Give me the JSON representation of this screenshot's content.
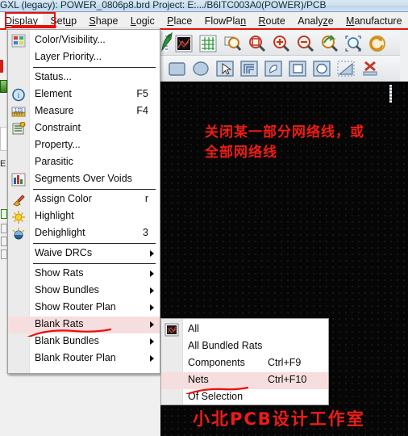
{
  "window": {
    "title": "GXL (legacy): POWER_0806p8.brd  Project: E:.../B6ITC003A0(POWER)/PCB"
  },
  "menubar": {
    "items": [
      {
        "label": "Display",
        "mnemonic": "D",
        "active": true
      },
      {
        "label": "Setup",
        "mnemonic": "u",
        "active": false
      },
      {
        "label": "Shape",
        "mnemonic": "S",
        "active": false
      },
      {
        "label": "Logic",
        "mnemonic": "L",
        "active": false
      },
      {
        "label": "Place",
        "mnemonic": "P",
        "active": false
      },
      {
        "label": "FlowPlan",
        "mnemonic": "n",
        "active": false
      },
      {
        "label": "Route",
        "mnemonic": "R",
        "active": false
      },
      {
        "label": "Analyze",
        "mnemonic": "z",
        "active": false
      },
      {
        "label": "Manufacture",
        "mnemonic": "M",
        "active": false
      }
    ]
  },
  "display_menu": {
    "items": [
      {
        "label": "Color/Visibility...",
        "accel": "",
        "submenu": false,
        "icon": "color-visibility-icon",
        "highlighted": false
      },
      {
        "label": "Layer Priority...",
        "accel": "",
        "submenu": false,
        "icon": "",
        "highlighted": false
      },
      {
        "separator": true
      },
      {
        "label": "Status...",
        "accel": "",
        "submenu": false,
        "icon": "",
        "highlighted": false
      },
      {
        "label": "Element",
        "accel": "F5",
        "submenu": false,
        "icon": "info-icon",
        "highlighted": false
      },
      {
        "label": "Measure",
        "accel": "F4",
        "submenu": false,
        "icon": "ruler-icon",
        "highlighted": false
      },
      {
        "label": "Constraint",
        "accel": "",
        "submenu": false,
        "icon": "constraint-icon",
        "highlighted": false
      },
      {
        "label": "Property...",
        "accel": "",
        "submenu": false,
        "icon": "",
        "highlighted": false
      },
      {
        "label": "Parasitic",
        "accel": "",
        "submenu": false,
        "icon": "",
        "highlighted": false
      },
      {
        "label": "Segments Over Voids",
        "accel": "",
        "submenu": false,
        "icon": "bargraph-icon",
        "highlighted": false
      },
      {
        "separator": true
      },
      {
        "label": "Assign Color",
        "accel": "r",
        "submenu": false,
        "icon": "paint-icon",
        "highlighted": false
      },
      {
        "label": "Highlight",
        "accel": "",
        "submenu": false,
        "icon": "highlight-icon",
        "highlighted": false
      },
      {
        "label": "Dehighlight",
        "accel": "3",
        "submenu": false,
        "icon": "dehighlight-icon",
        "highlighted": false
      },
      {
        "separator": true
      },
      {
        "label": "Waive DRCs",
        "accel": "",
        "submenu": true,
        "icon": "",
        "highlighted": false
      },
      {
        "separator": true
      },
      {
        "label": "Show Rats",
        "accel": "",
        "submenu": true,
        "icon": "",
        "highlighted": false
      },
      {
        "label": "Show Bundles",
        "accel": "",
        "submenu": true,
        "icon": "",
        "highlighted": false
      },
      {
        "label": "Show Router Plan",
        "accel": "",
        "submenu": true,
        "icon": "",
        "highlighted": false
      },
      {
        "label": "Blank Rats",
        "accel": "",
        "submenu": true,
        "icon": "",
        "highlighted": true
      },
      {
        "label": "Blank Bundles",
        "accel": "",
        "submenu": true,
        "icon": "",
        "highlighted": false
      },
      {
        "label": "Blank Router Plan",
        "accel": "",
        "submenu": true,
        "icon": "",
        "highlighted": false
      }
    ]
  },
  "blank_rats_submenu": {
    "items": [
      {
        "label": "All",
        "accel": "",
        "icon": "rats-icon",
        "highlighted": false
      },
      {
        "label": "All Bundled Rats",
        "accel": "",
        "icon": "",
        "highlighted": false
      },
      {
        "label": "Components",
        "accel": "Ctrl+F9",
        "icon": "",
        "highlighted": false
      },
      {
        "label": "Nets",
        "accel": "Ctrl+F10",
        "icon": "",
        "highlighted": true
      },
      {
        "label": "Of Selection",
        "accel": "",
        "icon": "",
        "highlighted": false
      }
    ]
  },
  "toolbar": {
    "row1": [
      {
        "name": "display-color-visibility-button"
      },
      {
        "name": "display-grid-button"
      },
      {
        "name": "zoom-fit-button"
      },
      {
        "name": "zoom-by-points-button"
      },
      {
        "name": "zoom-in-button"
      },
      {
        "name": "zoom-out-button"
      },
      {
        "name": "zoom-previous-button"
      },
      {
        "name": "zoom-world-button"
      },
      {
        "name": "refresh-button"
      }
    ],
    "row2": [
      {
        "name": "shape-rectangle-button"
      },
      {
        "name": "shape-circle-button"
      },
      {
        "name": "select-arrow-button"
      },
      {
        "name": "shape-layers-button"
      },
      {
        "name": "shape-arc-button"
      },
      {
        "name": "shape-square-outline-button"
      },
      {
        "name": "shape-circle-outline-button"
      },
      {
        "name": "shape-polygon-button"
      },
      {
        "name": "shape-delete-button"
      }
    ]
  },
  "canvas": {
    "annotation_line1": "关闭某一部分网络线，或",
    "annotation_line2": "全部网络线",
    "watermark": "小北PCB设计工作室",
    "background_color": "#060606",
    "annotation_color": "#ee1b15"
  },
  "colors": {
    "accent_red": "#dc1b10",
    "highlight_pink": "#f7dede",
    "menu_bg": "#ffffff",
    "menu_gutter": "#ebebeb",
    "toolbar_bg": "#eef0f2"
  }
}
